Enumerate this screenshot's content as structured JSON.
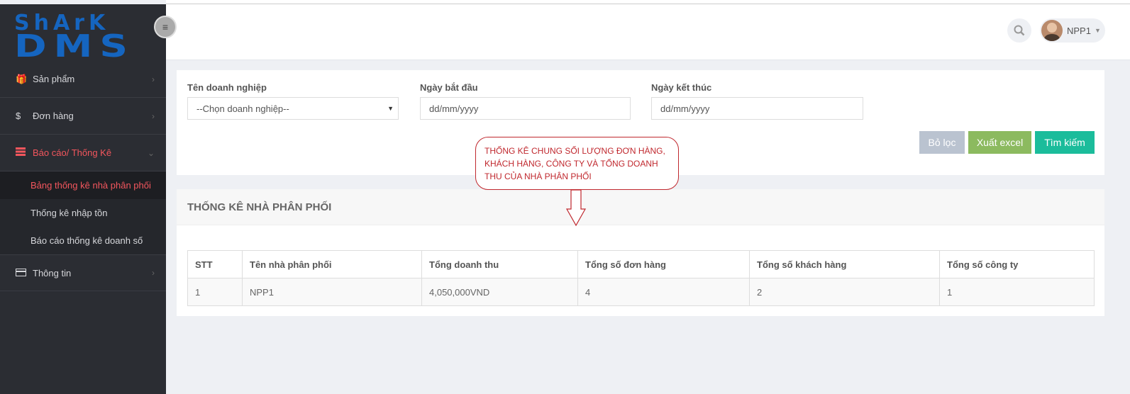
{
  "logo": {
    "line1": "ShArK",
    "line2": "DMS"
  },
  "sidebar": {
    "items": [
      {
        "label": "Sản phẩm",
        "icon": "gift-icon"
      },
      {
        "label": "Đơn hàng",
        "icon": "dollar-icon"
      },
      {
        "label": "Báo cáo/ Thống Kê",
        "icon": "report-icon",
        "active": true
      },
      {
        "label": "Thông tin",
        "icon": "card-icon"
      }
    ],
    "subitems": [
      {
        "label": "Bảng thống kê nhà phân phối",
        "current": true
      },
      {
        "label": "Thống kê nhập tồn"
      },
      {
        "label": "Báo cáo thống kê doanh số"
      }
    ]
  },
  "header": {
    "user_name": "NPP1"
  },
  "filter": {
    "company_label": "Tên doanh nghiệp",
    "company_value": "--Chọn doanh nghiệp--",
    "start_label": "Ngày bắt đầu",
    "start_placeholder": "dd/mm/yyyy",
    "end_label": "Ngày kết thúc",
    "end_placeholder": "dd/mm/yyyy",
    "clear_label": "Bỏ lọc",
    "excel_label": "Xuất excel",
    "search_label": "Tìm kiếm"
  },
  "callout": {
    "text": "THỐNG KÊ CHUNG SỐI LƯỢNG ĐƠN HÀNG, KHÁCH HÀNG, CÔNG TY VÀ TỔNG DOANH THU CỦA NHÀ PHÂN PHỐI"
  },
  "stats": {
    "title": "THỐNG KÊ NHÀ PHÂN PHỐI",
    "columns": [
      "STT",
      "Tên nhà phân phối",
      "Tổng doanh thu",
      "Tổng số đơn hàng",
      "Tổng số khách hàng",
      "Tổng số công ty"
    ],
    "rows": [
      [
        "1",
        "NPP1",
        "4,050,000VND",
        "4",
        "2",
        "1"
      ]
    ]
  },
  "colors": {
    "sidebar_bg": "#2b2d33",
    "accent_red": "#f3565d",
    "btn_clear": "#bac3d0",
    "btn_excel": "#8cba5f",
    "btn_search": "#1bbc9b"
  }
}
